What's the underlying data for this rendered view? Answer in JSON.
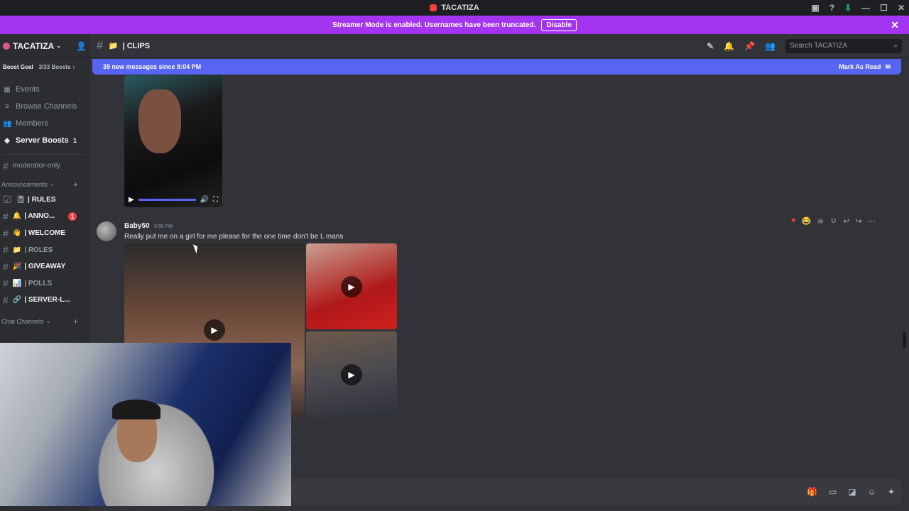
{
  "window": {
    "title": "TACATIZA"
  },
  "banner": {
    "text": "Streamer Mode is enabled. Usernames have been truncated.",
    "button": "Disable"
  },
  "server": {
    "name": "TACATIZA",
    "boost_goal": "Boost Goal",
    "boost_count": "3/33 Boosts"
  },
  "nav": [
    {
      "label": "Events",
      "icon": "calendar-icon"
    },
    {
      "label": "Browse Channels",
      "icon": "browse-icon"
    },
    {
      "label": "Members",
      "icon": "members-icon"
    },
    {
      "label": "Server Boosts",
      "icon": "boost-icon",
      "badge": "1"
    }
  ],
  "moderator_channel": "moderator-only",
  "categories": {
    "announcements": "Announcements",
    "chat": "Chat Channels"
  },
  "channels": [
    {
      "label": "| RULES",
      "emoji": "📓",
      "unread": true
    },
    {
      "label": "| ANNO...",
      "emoji": "🔔",
      "unread": true,
      "badge": "1"
    },
    {
      "label": "| WELCOME",
      "emoji": "👋",
      "unread": true
    },
    {
      "label": "| ROLES",
      "emoji": "📁",
      "unread": false
    },
    {
      "label": "| GIVEAWAY",
      "emoji": "🎉",
      "unread": true
    },
    {
      "label": "| POLLS",
      "emoji": "📊",
      "unread": false
    },
    {
      "label": "| SERVER-L...",
      "emoji": "🔗",
      "unread": true
    }
  ],
  "header": {
    "channel": "| CLIPS",
    "search_placeholder": "Search TACATIZA"
  },
  "new_messages": {
    "text": "39 new messages since 8:04 PM",
    "action": "Mark As Read"
  },
  "message": {
    "author": "Baby50",
    "time": "9:55 PM",
    "text": "Really put me on a girl for me please for the one time don't be L mans"
  }
}
